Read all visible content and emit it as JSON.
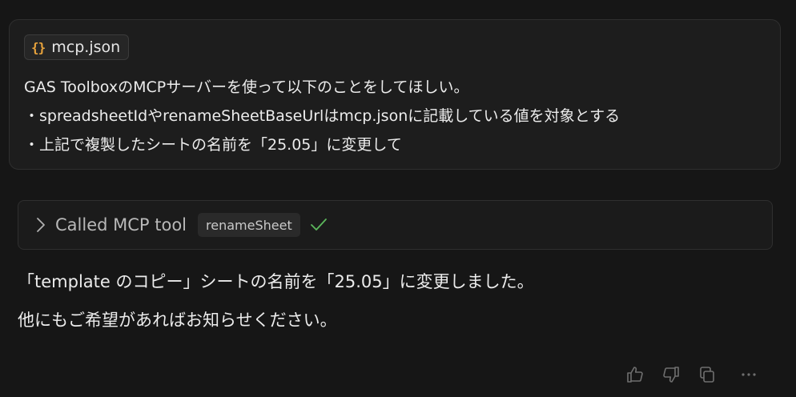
{
  "user_message": {
    "attachment": {
      "icon": "json-braces-icon",
      "icon_glyph": "{}",
      "icon_color": "#e8a33c",
      "label": "mcp.json"
    },
    "lines": [
      "GAS ToolboxのMCPサーバーを使って以下のことをしてほしい。",
      "・spreadsheetIdやrenameSheetBaseUrlはmcp.jsonに記載している値を対象とする",
      "・上記で複製したシートの名前を「25.05」に変更して"
    ]
  },
  "tool_call": {
    "icon": "chevron-right-icon",
    "label": "Called MCP tool",
    "tool_name": "renameSheet",
    "status_icon": "check-icon",
    "status_color": "#5cb85c"
  },
  "assistant_message": {
    "paragraphs": [
      "「template のコピー」シートの名前を「25.05」に変更しました。",
      "他にもご希望があればお知らせください。"
    ]
  },
  "actions": [
    {
      "name": "thumbs-up-icon"
    },
    {
      "name": "thumbs-down-icon"
    },
    {
      "name": "copy-icon"
    },
    {
      "name": "more-icon"
    }
  ]
}
